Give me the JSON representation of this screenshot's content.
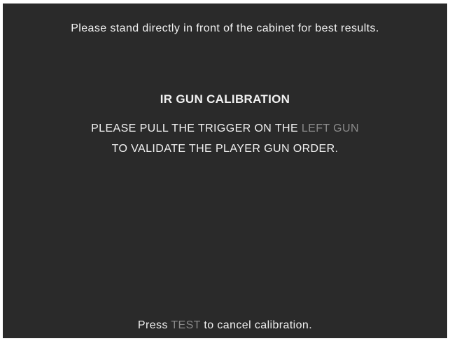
{
  "colors": {
    "background": "#2a2a2a",
    "text": "#f2f2f2",
    "highlight": "#8a8a8a"
  },
  "screen": {
    "position_hint": "Please stand directly in front of the cabinet for best results.",
    "title": "IR GUN CALIBRATION",
    "instruction_line1_prefix": "PLEASE PULL THE TRIGGER ON THE",
    "instruction_line1_highlight": "LEFT GUN",
    "instruction_line2": "TO VALIDATE THE PLAYER GUN ORDER.",
    "footer_prefix": "Press",
    "footer_key": "TEST",
    "footer_suffix": "to cancel calibration."
  }
}
